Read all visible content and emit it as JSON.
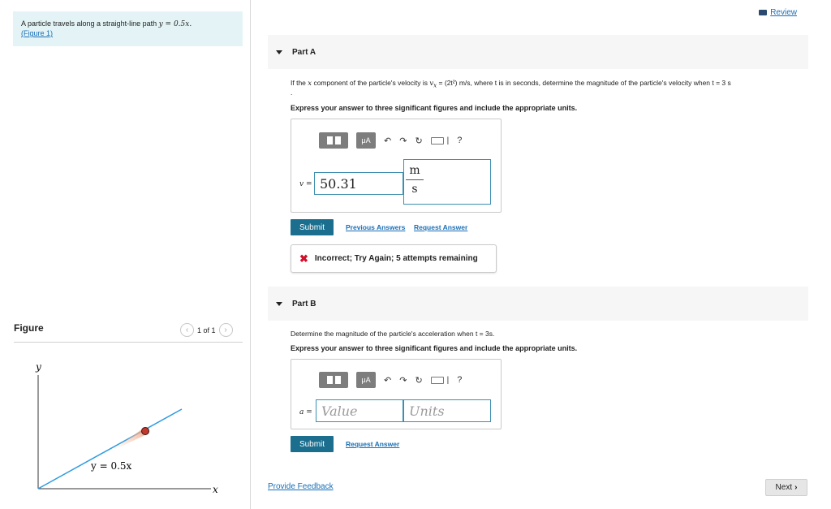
{
  "problem": {
    "text": "A particle travels along a straight-line path",
    "equation": "y = 0.5x.",
    "figure_link": "(Figure 1)"
  },
  "figure": {
    "label": "Figure",
    "pager_text": "1 of 1",
    "axis_y": "y",
    "axis_x": "x",
    "curve_label": "y = 0.5x"
  },
  "review": {
    "label": "Review"
  },
  "part_a": {
    "title": "Part A",
    "question_prefix": "If the",
    "question_x": "x",
    "question_mid": "component of the particle's velocity is",
    "question_eq": "v",
    "question_eq_sub": "x",
    "question_expr": "= (2t²) m/s,",
    "question_rest": "where t is in seconds, determine the magnitude of the particle's velocity when t = 3 s",
    "question_dot": ".",
    "instruction": "Express your answer to three significant figures and include the appropriate units.",
    "var_label": "v =",
    "value": "50.31",
    "unit_num": "m",
    "unit_den": "s",
    "submit": "Submit",
    "previous_answers": "Previous Answers",
    "request_answer": "Request Answer",
    "feedback_icon": "✖",
    "feedback": "Incorrect; Try Again; 5 attempts remaining"
  },
  "part_b": {
    "title": "Part B",
    "question": "Determine the magnitude of the particle's acceleration when t = 3s.",
    "instruction": "Express your answer to three significant figures and include the appropriate units.",
    "var_label": "a =",
    "value_placeholder": "Value",
    "units_placeholder": "Units",
    "submit": "Submit",
    "request_answer": "Request Answer"
  },
  "toolbar": {
    "mu": "μA",
    "undo": "↶",
    "redo": "↷",
    "reset": "↻",
    "help": "?"
  },
  "footer": {
    "provide_feedback": "Provide Feedback",
    "next": "Next",
    "next_icon": "›"
  }
}
